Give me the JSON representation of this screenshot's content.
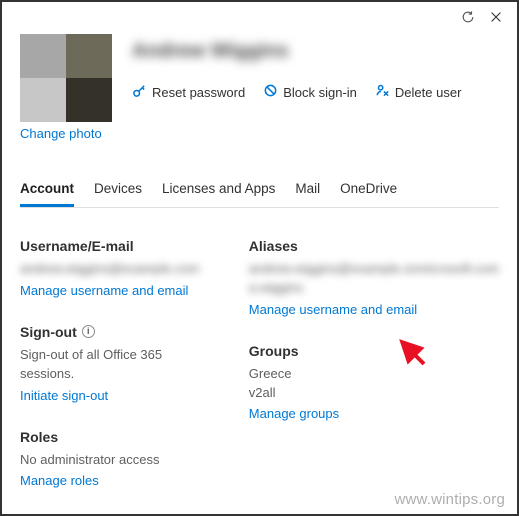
{
  "window": {
    "refresh_icon": "refresh",
    "close_icon": "close"
  },
  "header": {
    "display_name": "Andrew Wiggins",
    "change_photo": "Change photo",
    "actions": {
      "reset_password": "Reset password",
      "block_signin": "Block sign-in",
      "delete_user": "Delete user"
    }
  },
  "tabs": {
    "account": "Account",
    "devices": "Devices",
    "licenses": "Licenses and Apps",
    "mail": "Mail",
    "onedrive": "OneDrive"
  },
  "account": {
    "username": {
      "title": "Username/E-mail",
      "value": "andrew.wiggins@example.com",
      "link": "Manage username and email"
    },
    "signout": {
      "title": "Sign-out",
      "body": "Sign-out of all Office 365 sessions.",
      "link": "Initiate sign-out"
    },
    "roles": {
      "title": "Roles",
      "body": "No administrator access",
      "link": "Manage roles"
    },
    "aliases": {
      "title": "Aliases",
      "value1": "andrew.wiggins@example.onmicrosoft.com",
      "value2": "a.wiggins",
      "link": "Manage username and email"
    },
    "groups": {
      "title": "Groups",
      "item1": "Greece",
      "item2": "v2all",
      "link": "Manage groups"
    }
  },
  "watermark": "www.wintips.org"
}
